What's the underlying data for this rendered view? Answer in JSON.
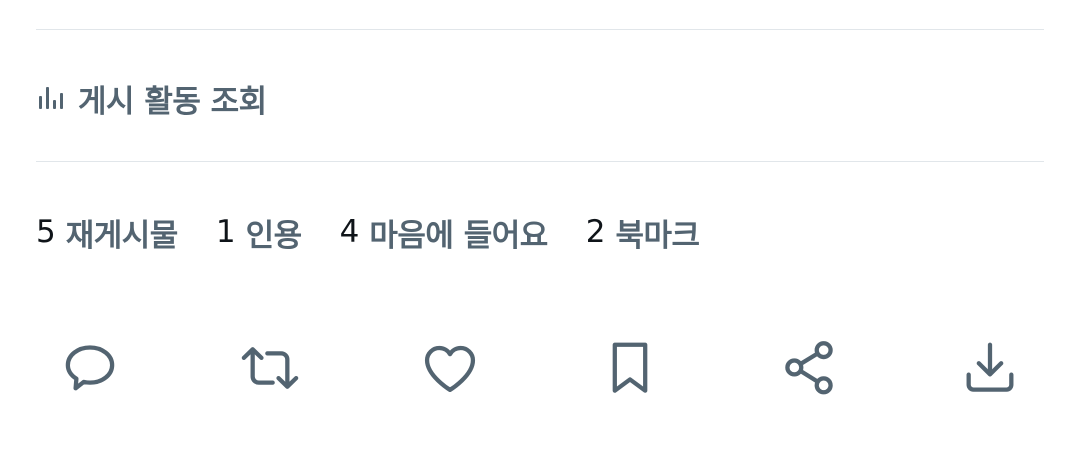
{
  "activity": {
    "icon": "bar-chart-icon",
    "label": "게시 활동 조회"
  },
  "stats": [
    {
      "count": "5",
      "label": "재게시물"
    },
    {
      "count": "1",
      "label": "인용"
    },
    {
      "count": "4",
      "label": "마음에 들어요"
    },
    {
      "count": "2",
      "label": "북마크"
    }
  ],
  "actions": [
    {
      "icon": "reply-icon"
    },
    {
      "icon": "repost-icon"
    },
    {
      "icon": "heart-icon"
    },
    {
      "icon": "bookmark-icon"
    },
    {
      "icon": "share-icon"
    },
    {
      "icon": "download-icon"
    }
  ],
  "colors": {
    "icon_gray": "#536471",
    "text_dark": "#0f1419",
    "divider": "#e1e6ea",
    "background": "#ffffff"
  }
}
